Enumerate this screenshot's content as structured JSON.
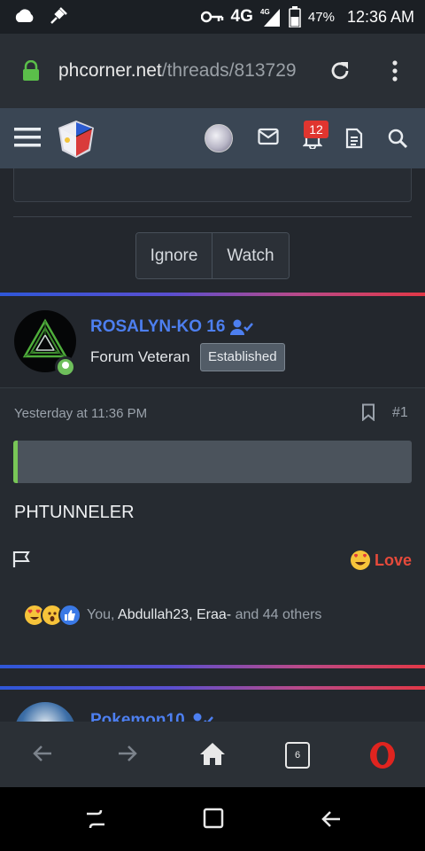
{
  "statusbar": {
    "network": "4G",
    "network_small": "4G",
    "battery": "47%",
    "time": "12:36 AM",
    "icons": [
      "cloud-icon",
      "satellite-icon",
      "key-icon",
      "signal-icon",
      "battery-icon"
    ]
  },
  "browser": {
    "url_host": "phcorner.net",
    "url_path": "/threads/813729",
    "icons": [
      "lock-icon",
      "reload-icon",
      "overflow-menu-icon"
    ]
  },
  "site_header": {
    "notification_count": "12",
    "icons": [
      "hamburger-icon",
      "site-logo",
      "avatar",
      "mail-icon",
      "bell-icon",
      "document-icon",
      "search-icon"
    ]
  },
  "member_actions": {
    "ignore_label": "Ignore",
    "watch_label": "Watch"
  },
  "post": {
    "username": "ROSALYN-KO 16",
    "user_title": "Forum Veteran",
    "user_banner": "Established",
    "date": "Yesterday at 11:36 PM",
    "number": "#1",
    "text": "PHTUNNELER",
    "reaction_label": "Love",
    "reactions_you": "You,",
    "reactions_user1": "Abdullah23,",
    "reactions_user2": "Eraa-",
    "reactions_rest": "and 44 others"
  },
  "next_post": {
    "username": "Pokemon10"
  },
  "bottom_nav": {
    "tab_count": "6",
    "icons": [
      "back-arrow-icon",
      "forward-arrow-icon",
      "home-icon",
      "tabs-icon",
      "opera-icon"
    ]
  },
  "colors": {
    "accent_blue": "#4d7ff0",
    "love_red": "#e64a3b",
    "online_green": "#6ebf5b",
    "badge_red": "#e0352f"
  }
}
